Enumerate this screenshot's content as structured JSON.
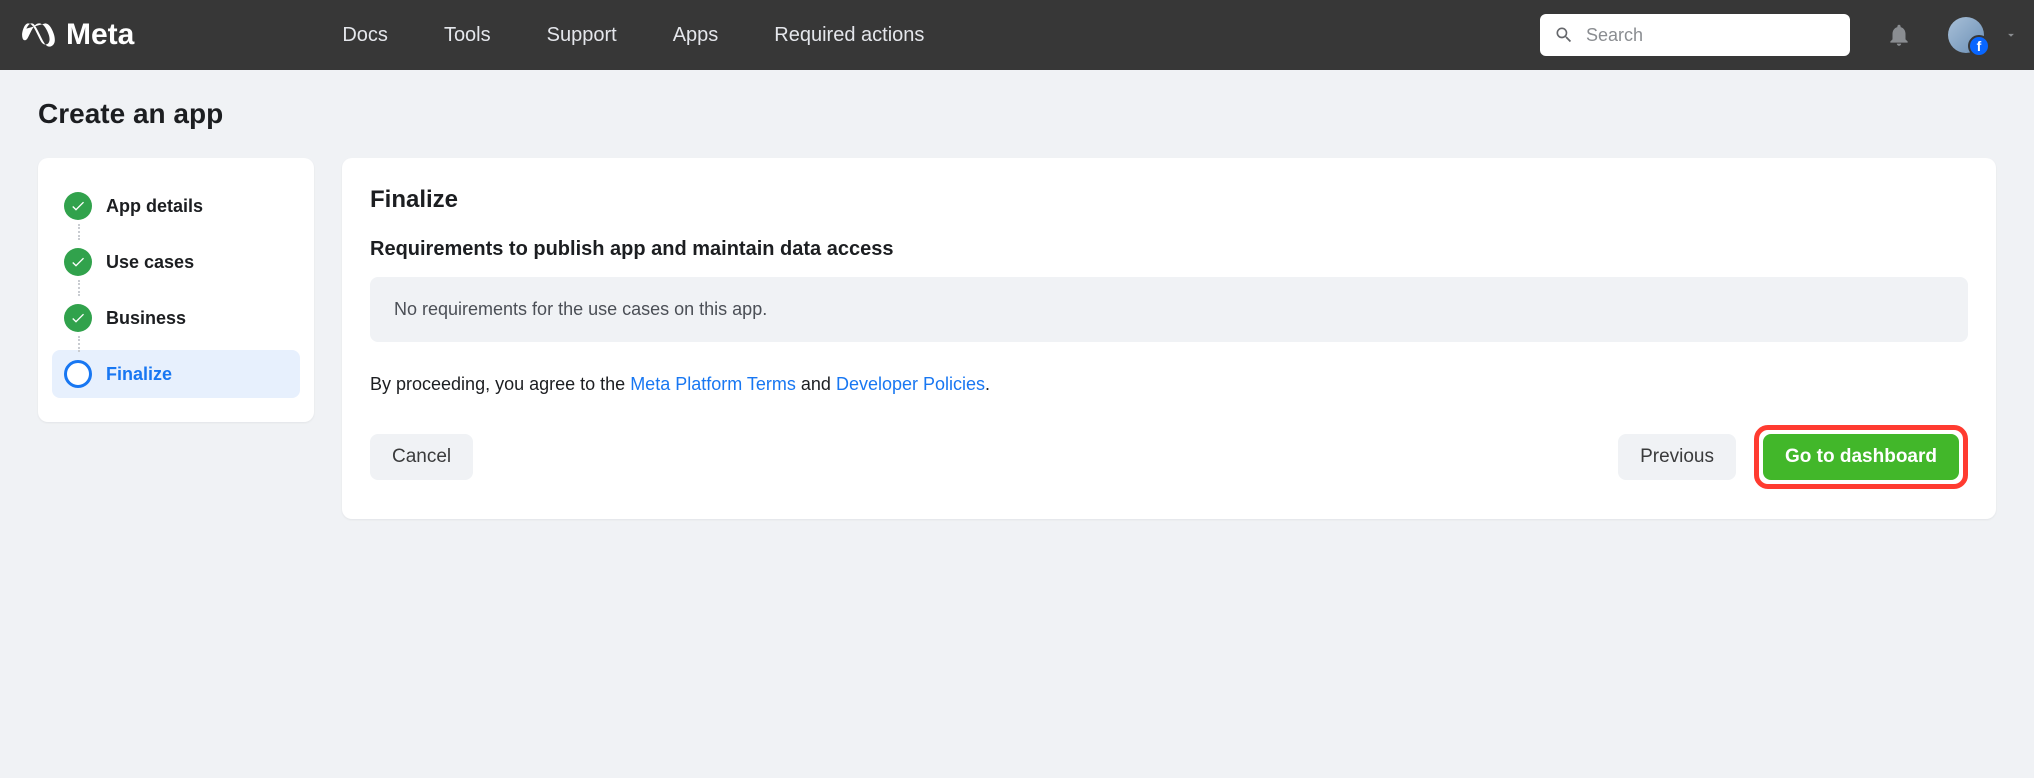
{
  "header": {
    "brand": "Meta",
    "nav": [
      "Docs",
      "Tools",
      "Support",
      "Apps",
      "Required actions"
    ],
    "search_placeholder": "Search",
    "avatar_badge": "f"
  },
  "page": {
    "title": "Create an app"
  },
  "sidebar": {
    "steps": [
      {
        "label": "App details",
        "state": "done"
      },
      {
        "label": "Use cases",
        "state": "done"
      },
      {
        "label": "Business",
        "state": "done"
      },
      {
        "label": "Finalize",
        "state": "current"
      }
    ]
  },
  "main": {
    "heading": "Finalize",
    "subheading": "Requirements to publish app and maintain data access",
    "info": "No requirements for the use cases on this app.",
    "agree_prefix": "By proceeding, you agree to the ",
    "link1": "Meta Platform Terms",
    "agree_mid": " and ",
    "link2": "Developer Policies",
    "agree_suffix": ".",
    "cancel": "Cancel",
    "previous": "Previous",
    "primary": "Go to dashboard"
  }
}
